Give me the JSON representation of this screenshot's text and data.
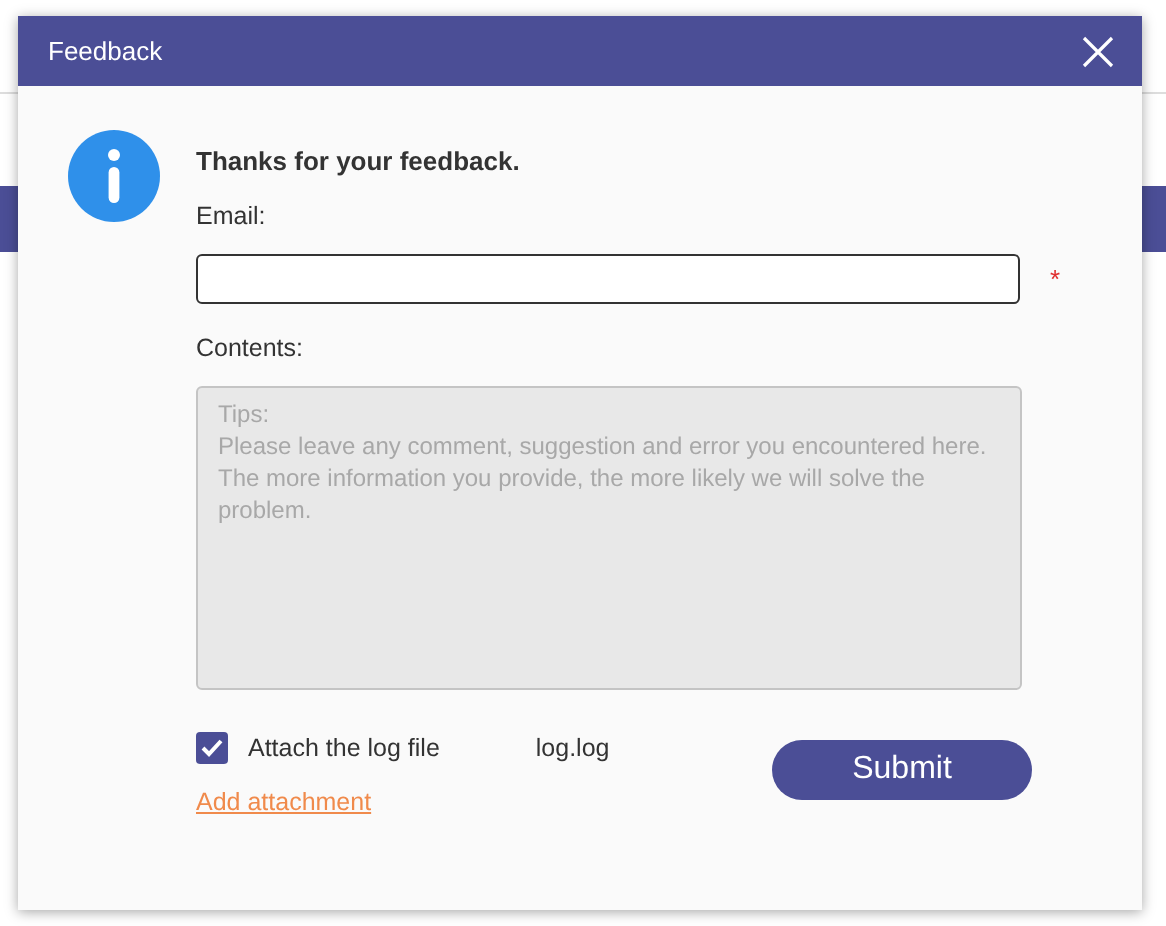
{
  "dialog": {
    "title": "Feedback",
    "heading": "Thanks for your feedback.",
    "email": {
      "label": "Email:",
      "required_mark": "*"
    },
    "contents": {
      "label": "Contents:",
      "placeholder": "Tips:\nPlease leave any comment, suggestion and error you encountered here. The more information you provide, the more likely we will solve the problem."
    },
    "attach_log": {
      "label": "Attach the log file",
      "checked": true,
      "file_name": "log.log"
    },
    "add_attachment_link": "Add attachment",
    "submit_button": "Submit"
  }
}
